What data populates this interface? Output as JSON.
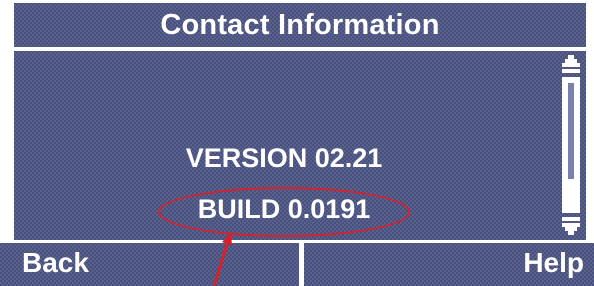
{
  "window": {
    "title": "Contact Information"
  },
  "content": {
    "version": "VERSION 02.21",
    "build": "BUILD 0.0191"
  },
  "softkeys": {
    "left_label": "Back",
    "right_label": "Help"
  },
  "scrollbar": {
    "position": 0.75
  },
  "colors": {
    "background": "#47507f",
    "text": "#ffffff",
    "annotation": "#d8202a"
  },
  "icons": {
    "scroll_up": "up-arrow-icon",
    "scroll_down": "down-arrow-icon",
    "annotation_arrow": "red-pointer-arrow-icon"
  }
}
